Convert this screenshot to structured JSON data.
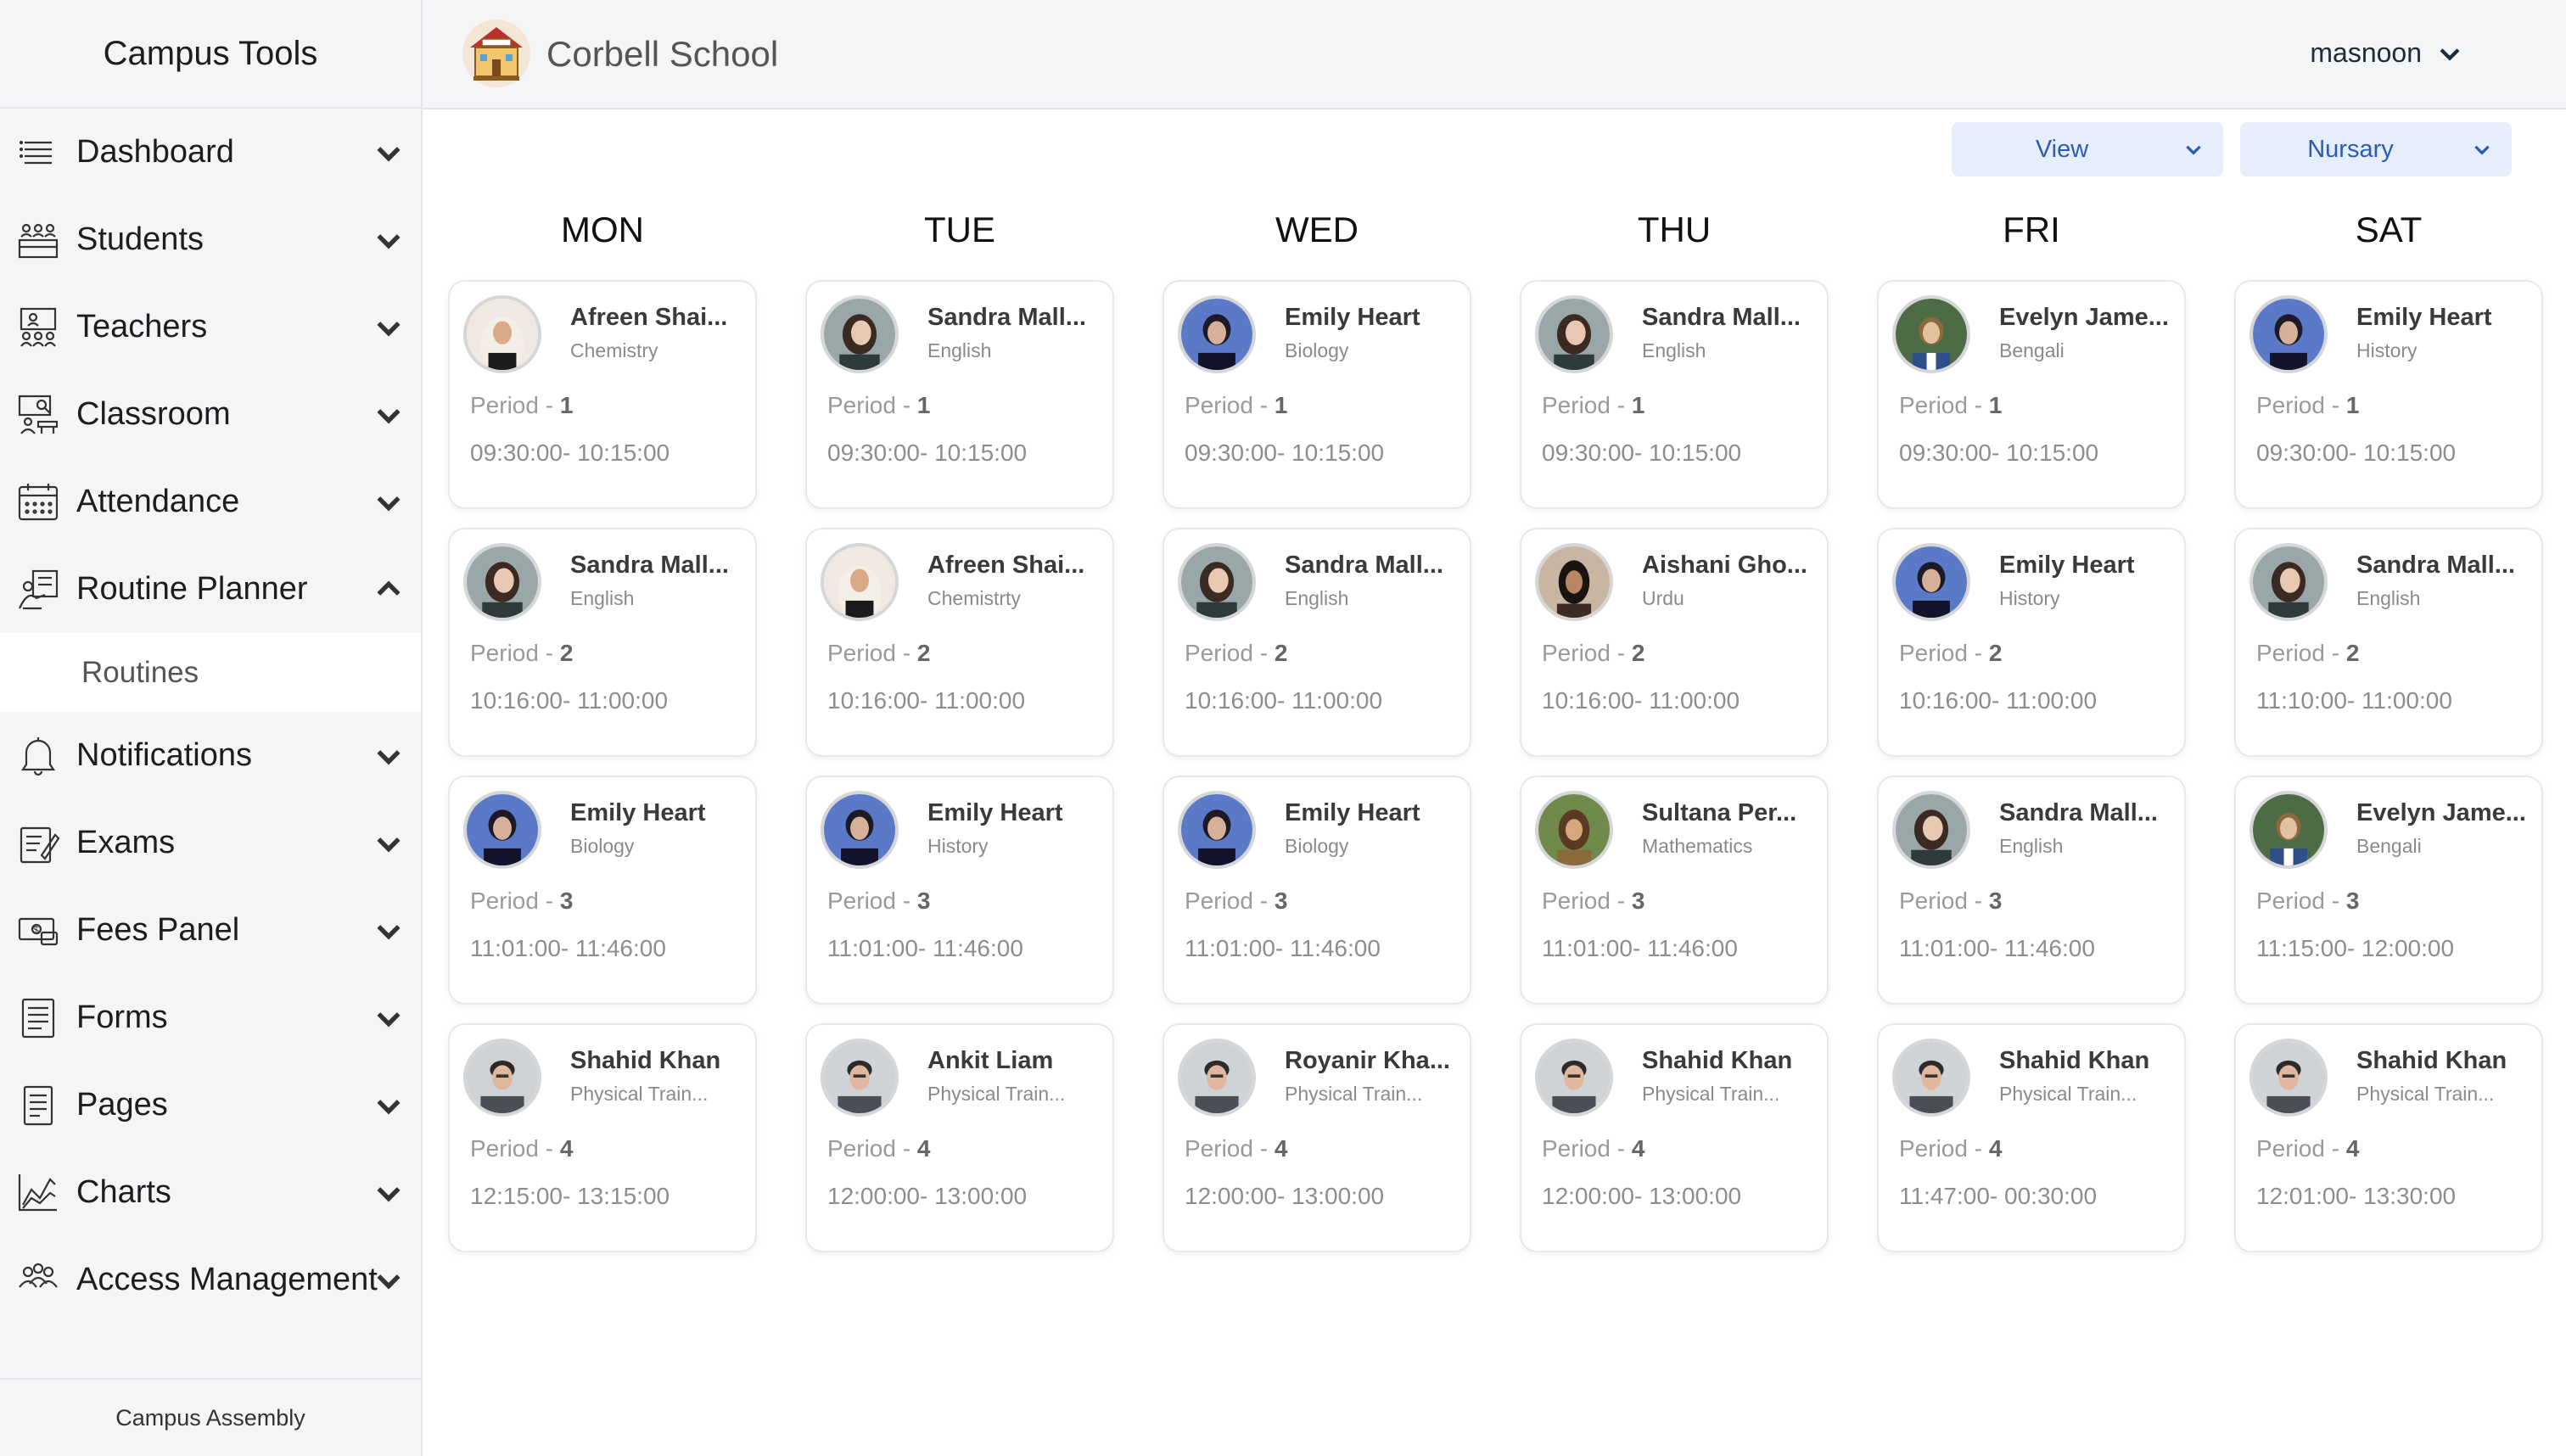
{
  "app": {
    "brand": "Campus Tools",
    "school_name": "Corbell School",
    "footer": "Campus Assembly"
  },
  "user": {
    "name": "masnoon"
  },
  "sidebar": {
    "items": [
      {
        "label": "Dashboard",
        "icon": "list-icon",
        "expanded": false
      },
      {
        "label": "Students",
        "icon": "students-icon",
        "expanded": false
      },
      {
        "label": "Teachers",
        "icon": "teachers-icon",
        "expanded": false
      },
      {
        "label": "Classroom",
        "icon": "classroom-icon",
        "expanded": false
      },
      {
        "label": "Attendance",
        "icon": "calendar-icon",
        "expanded": false
      },
      {
        "label": "Routine Planner",
        "icon": "routine-icon",
        "expanded": true,
        "sub": "Routines"
      },
      {
        "label": "Notifications",
        "icon": "bell-icon",
        "expanded": false
      },
      {
        "label": "Exams",
        "icon": "exam-icon",
        "expanded": false
      },
      {
        "label": "Fees Panel",
        "icon": "money-icon",
        "expanded": false
      },
      {
        "label": "Forms",
        "icon": "form-icon",
        "expanded": false
      },
      {
        "label": "Pages",
        "icon": "pages-icon",
        "expanded": false
      },
      {
        "label": "Charts",
        "icon": "chart-icon",
        "expanded": false
      },
      {
        "label": "Access Management",
        "icon": "people-icon",
        "expanded": false
      }
    ]
  },
  "filters": {
    "view": "View",
    "class": "Nursary"
  },
  "colors": {
    "accent": "#2b5bb8",
    "select_bg": "#e7eefb",
    "sidebar_bg": "#f4f5f7"
  },
  "routine": {
    "days": [
      {
        "day": "MON",
        "slots": [
          {
            "name": "Afreen Shai...",
            "subject": "Chemistry",
            "period_label": "Period - ",
            "period": "1",
            "time": "09:30:00- 10:15:00",
            "avatar": "hijab"
          },
          {
            "name": "Sandra Mall...",
            "subject": "English",
            "period_label": "Period - ",
            "period": "2",
            "time": "10:16:00- 11:00:00",
            "avatar": "sandra"
          },
          {
            "name": "Emily Heart",
            "subject": "Biology",
            "period_label": "Period - ",
            "period": "3",
            "time": "11:01:00- 11:46:00",
            "avatar": "emily"
          },
          {
            "name": "Shahid Khan",
            "subject": "Physical Train...",
            "period_label": "Period - ",
            "period": "4",
            "time": "12:15:00- 13:15:00",
            "avatar": "man"
          }
        ]
      },
      {
        "day": "TUE",
        "slots": [
          {
            "name": "Sandra Mall...",
            "subject": "English",
            "period_label": "Period - ",
            "period": "1",
            "time": "09:30:00- 10:15:00",
            "avatar": "sandra"
          },
          {
            "name": "Afreen Shai...",
            "subject": "Chemistrty",
            "period_label": "Period - ",
            "period": "2",
            "time": "10:16:00- 11:00:00",
            "avatar": "hijab"
          },
          {
            "name": "Emily Heart",
            "subject": "History",
            "period_label": "Period - ",
            "period": "3",
            "time": "11:01:00- 11:46:00",
            "avatar": "emily"
          },
          {
            "name": "Ankit Liam",
            "subject": "Physical Train...",
            "period_label": "Period - ",
            "period": "4",
            "time": "12:00:00- 13:00:00",
            "avatar": "man"
          }
        ]
      },
      {
        "day": "WED",
        "slots": [
          {
            "name": "Emily Heart",
            "subject": "Biology",
            "period_label": "Period - ",
            "period": "1",
            "time": "09:30:00- 10:15:00",
            "avatar": "emily"
          },
          {
            "name": "Sandra Mall...",
            "subject": "English",
            "period_label": "Period - ",
            "period": "2",
            "time": "10:16:00- 11:00:00",
            "avatar": "sandra"
          },
          {
            "name": "Emily Heart",
            "subject": "Biology",
            "period_label": "Period - ",
            "period": "3",
            "time": "11:01:00- 11:46:00",
            "avatar": "emily"
          },
          {
            "name": "Royanir Kha...",
            "subject": "Physical Train...",
            "period_label": "Period - ",
            "period": "4",
            "time": "12:00:00- 13:00:00",
            "avatar": "man"
          }
        ]
      },
      {
        "day": "THU",
        "slots": [
          {
            "name": "Sandra Mall...",
            "subject": "English",
            "period_label": "Period - ",
            "period": "1",
            "time": "09:30:00- 10:15:00",
            "avatar": "sandra"
          },
          {
            "name": "Aishani Gho...",
            "subject": "Urdu",
            "period_label": "Period - ",
            "period": "2",
            "time": "10:16:00- 11:00:00",
            "avatar": "aishani"
          },
          {
            "name": "Sultana Per...",
            "subject": "Mathematics",
            "period_label": "Period - ",
            "period": "3",
            "time": "11:01:00- 11:46:00",
            "avatar": "sultana"
          },
          {
            "name": "Shahid Khan",
            "subject": "Physical Train...",
            "period_label": "Period - ",
            "period": "4",
            "time": "12:00:00- 13:00:00",
            "avatar": "man"
          }
        ]
      },
      {
        "day": "FRI",
        "slots": [
          {
            "name": "Evelyn Jame...",
            "subject": "Bengali",
            "period_label": "Period - ",
            "period": "1",
            "time": "09:30:00- 10:15:00",
            "avatar": "evelyn"
          },
          {
            "name": "Emily Heart",
            "subject": "History",
            "period_label": "Period - ",
            "period": "2",
            "time": "10:16:00- 11:00:00",
            "avatar": "emily"
          },
          {
            "name": "Sandra Mall...",
            "subject": "English",
            "period_label": "Period - ",
            "period": "3",
            "time": "11:01:00- 11:46:00",
            "avatar": "sandra"
          },
          {
            "name": "Shahid Khan",
            "subject": "Physical Train...",
            "period_label": "Period - ",
            "period": "4",
            "time": "11:47:00- 00:30:00",
            "avatar": "man"
          }
        ]
      },
      {
        "day": "SAT",
        "slots": [
          {
            "name": "Emily Heart",
            "subject": "History",
            "period_label": "Period - ",
            "period": "1",
            "time": "09:30:00- 10:15:00",
            "avatar": "emily"
          },
          {
            "name": "Sandra Mall...",
            "subject": "English",
            "period_label": "Period - ",
            "period": "2",
            "time": "11:10:00- 11:00:00",
            "avatar": "sandra"
          },
          {
            "name": "Evelyn Jame...",
            "subject": "Bengali",
            "period_label": "Period - ",
            "period": "3",
            "time": "11:15:00- 12:00:00",
            "avatar": "evelyn"
          },
          {
            "name": "Shahid Khan",
            "subject": "Physical Train...",
            "period_label": "Period - ",
            "period": "4",
            "time": "12:01:00- 13:30:00",
            "avatar": "man"
          }
        ]
      }
    ]
  }
}
